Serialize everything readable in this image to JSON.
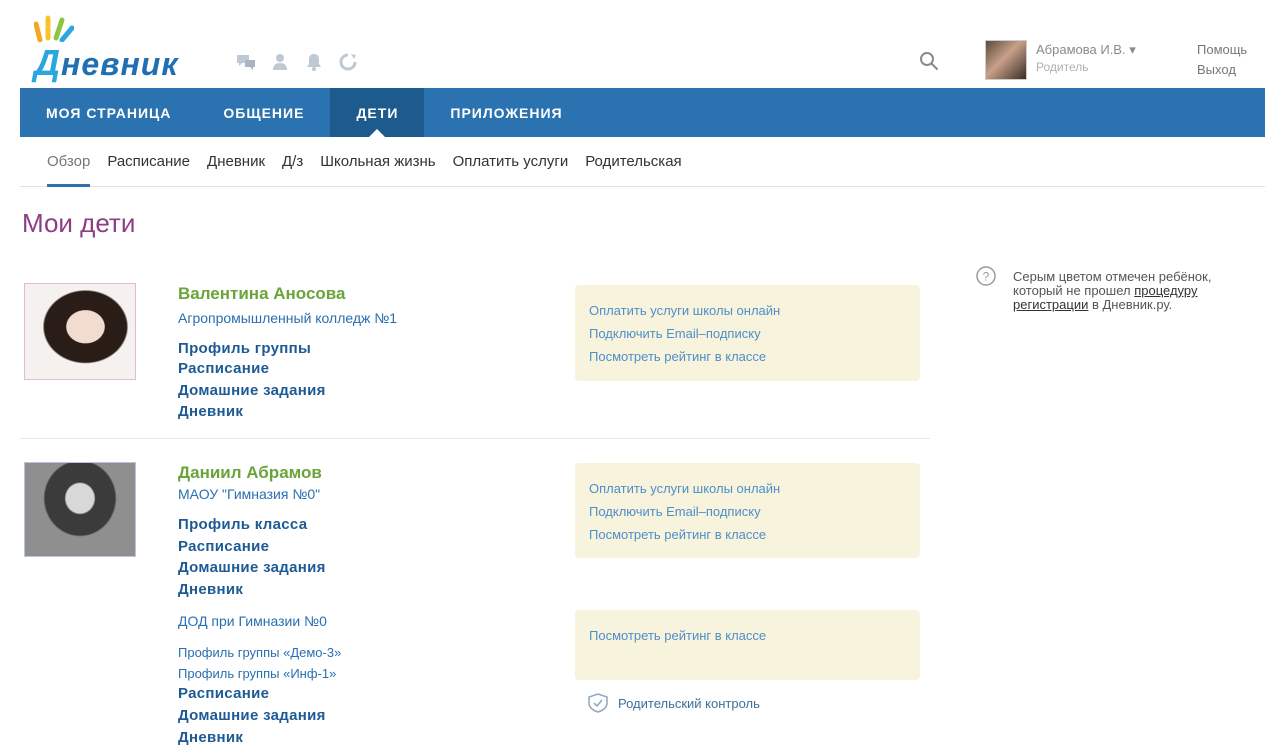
{
  "header": {
    "logo_first": "Д",
    "logo_rest": "невник",
    "icons": [
      "chat-icon",
      "person-icon",
      "bell-icon",
      "refresh-icon"
    ],
    "user_name": "Абрамова И.В. ▾",
    "user_role": "Родитель",
    "help": "Помощь",
    "logout": "Выход"
  },
  "nav": {
    "tabs": [
      {
        "label": "МОЯ СТРАНИЦА",
        "active": false
      },
      {
        "label": "ОБЩЕНИЕ",
        "active": false
      },
      {
        "label": "ДЕТИ",
        "active": true
      },
      {
        "label": "ПРИЛОЖЕНИЯ",
        "active": false
      }
    ],
    "subtabs": [
      {
        "label": "Обзор",
        "active": true
      },
      {
        "label": "Расписание",
        "active": false
      },
      {
        "label": "Дневник",
        "active": false
      },
      {
        "label": "Д/з",
        "active": false
      },
      {
        "label": "Школьная жизнь",
        "active": false
      },
      {
        "label": "Оплатить услуги",
        "active": false
      },
      {
        "label": "Родительская",
        "active": false
      }
    ]
  },
  "page": {
    "title": "Мои дети"
  },
  "children": [
    {
      "name": "Валентина Аносова",
      "school": "Агропромышленный колледж №1",
      "links": [
        "Профиль группы",
        "Расписание",
        "Домашние задания",
        "Дневник"
      ],
      "actions": [
        "Оплатить услуги школы онлайн",
        "Подключить Email–подписку",
        "Посмотреть рейтинг в классе"
      ]
    },
    {
      "name": "Даниил Абрамов",
      "school": "МАОУ \"Гимназия №0\"",
      "links": [
        "Профиль класса",
        "Расписание",
        "Домашние задания",
        "Дневник"
      ],
      "actions": [
        "Оплатить услуги школы онлайн",
        "Подключить Email–подписку",
        "Посмотреть рейтинг в классе"
      ],
      "extra_school": "ДОД при Гимназии №0",
      "extra_small_links": [
        "Профиль группы «Демо-3»",
        "Профиль группы «Инф-1»"
      ],
      "extra_links": [
        "Расписание",
        "Домашние задания",
        "Дневник"
      ],
      "extra_actions": [
        "Посмотреть рейтинг в классе"
      ],
      "parent_control": "Родительский контроль"
    }
  ],
  "info": {
    "text_before": "Серым цветом отмечен ребёнок, который не прошел ",
    "link": "процедуру регистрации",
    "text_after": " в Дневник.ру."
  },
  "colors": {
    "nav_blue": "#2b73b0",
    "nav_active": "#1d5a8e",
    "title_purple": "#8c3d84",
    "name_green": "#6aa43a",
    "box_bg": "#f8f3dd"
  }
}
